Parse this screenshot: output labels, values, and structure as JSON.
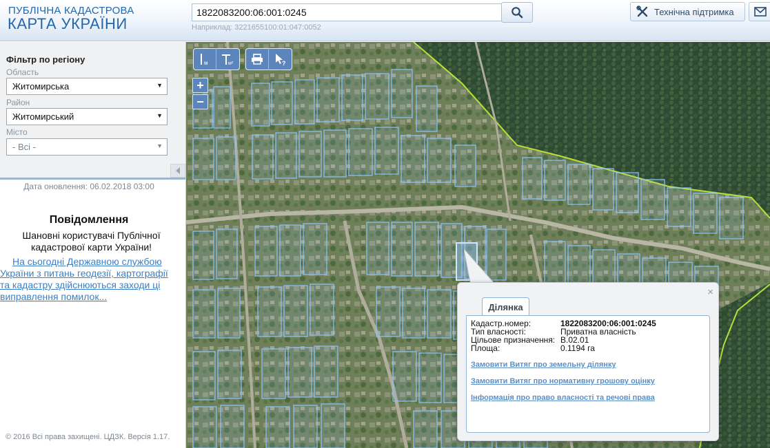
{
  "header": {
    "logo_line1": "ПУБЛІЧНА КАДАСТРОВА",
    "logo_line2": "КАРТА УКРАЇНИ",
    "search_value": "1822083200:06:001:0245",
    "search_hint": "Наприклад: 3221655100:01:047:0052",
    "search_icon": "magnifier-icon",
    "support_label": "Технічна підтримка",
    "support_icon": "tools-icon",
    "mail_icon": "envelope-icon"
  },
  "filter": {
    "title": "Фільтр по регіону",
    "oblast_label": "Область",
    "oblast_value": "Житомирська",
    "rayon_label": "Район",
    "rayon_value": "Житомирський",
    "misto_label": "Місто",
    "misto_value": "- Всі -"
  },
  "sidebar": {
    "update_date": "Дата оновлення: 06.02.2018 03:00",
    "notice_title": "Повідомлення",
    "notice_greeting": "Шановні користувачі Публічної кадастрової карти України!",
    "notice_link": "На сьогодні Державною службою\nУкраїни з питань геодезії, картографії\nта кадастру здійснюються заходи ці\nвиправлення помилок...",
    "copyright": "© 2016 Всі права захищені. ЦДЗК. Версія 1.17."
  },
  "map_tools": {
    "measure_length_unit": "м",
    "measure_area_unit": "м²",
    "print_icon": "printer-icon",
    "identify_icon": "cursor-question-icon",
    "zoom_in": "+",
    "zoom_out": "−"
  },
  "popup": {
    "tab": "Ділянка",
    "close": "×",
    "properties": [
      {
        "label": "Кадастр.номер:",
        "value": "1822083200:06:001:0245"
      },
      {
        "label": "Тип власності:",
        "value": "Приватна власність"
      },
      {
        "label": "Цільове призначення:",
        "value": "В.02.01"
      },
      {
        "label": "Площа:",
        "value": "0.1194 га"
      }
    ],
    "links": [
      "Замовити Витяг про земельну ділянку",
      "Замовити Витяг про нормативну грошову оцінку",
      "Інформація про право власності та речові права"
    ]
  },
  "colors": {
    "brand": "#2466a8",
    "parcel_outline": "#8cc4ff",
    "boundary": "#b8e03a",
    "forest": "#2f4a32",
    "link": "#3a7fc4"
  }
}
